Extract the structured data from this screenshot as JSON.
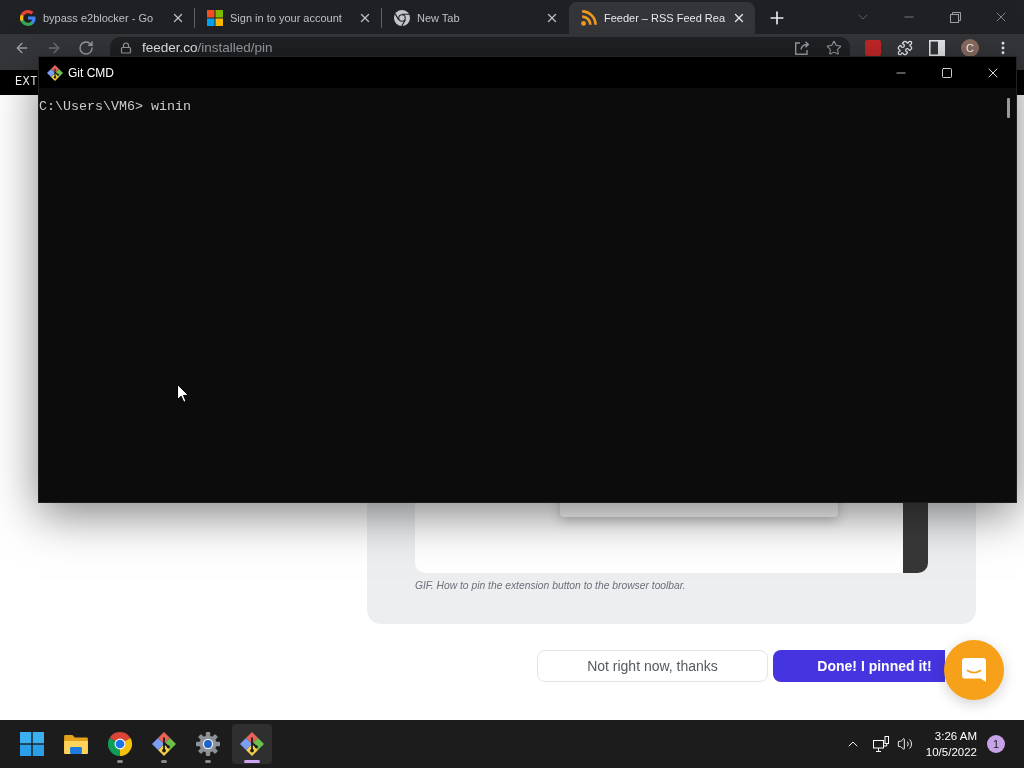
{
  "browser": {
    "tabs": [
      {
        "kind": "search",
        "label": "bypass e2blocker - Go",
        "selected": false
      },
      {
        "kind": "account",
        "label": "Sign in to your account",
        "selected": false
      },
      {
        "kind": "newtab",
        "label": "New Tab",
        "selected": false
      },
      {
        "kind": "feed",
        "label": "Feeder – RSS Feed Rea",
        "selected": true
      }
    ],
    "address": {
      "host": "feeder.co",
      "path": "/installed/pin"
    },
    "profile_initial": "C"
  },
  "page": {
    "banner": "EXT",
    "gif_caption": "GIF. How to pin the extension button to the browser toolbar.",
    "buttons": [
      {
        "kind": "secondary",
        "label": "Not right now, thanks"
      },
      {
        "kind": "primary",
        "label": "Done! I pinned it!"
      }
    ]
  },
  "terminal": {
    "title": "Git CMD",
    "lines": [
      "C:\\Users\\VM6> winin"
    ]
  },
  "taskbar": {
    "apps": [
      {
        "kind": "folder",
        "running": false,
        "selected": false
      },
      {
        "kind": "browser",
        "running": true,
        "selected": false
      },
      {
        "kind": "git",
        "running": true,
        "selected": false
      },
      {
        "kind": "settings",
        "running": true,
        "selected": false
      },
      {
        "kind": "terminal",
        "running": true,
        "selected": true
      }
    ],
    "clock": {
      "time": "3:26 AM",
      "date": "10/5/2022"
    },
    "notifications": "1"
  }
}
